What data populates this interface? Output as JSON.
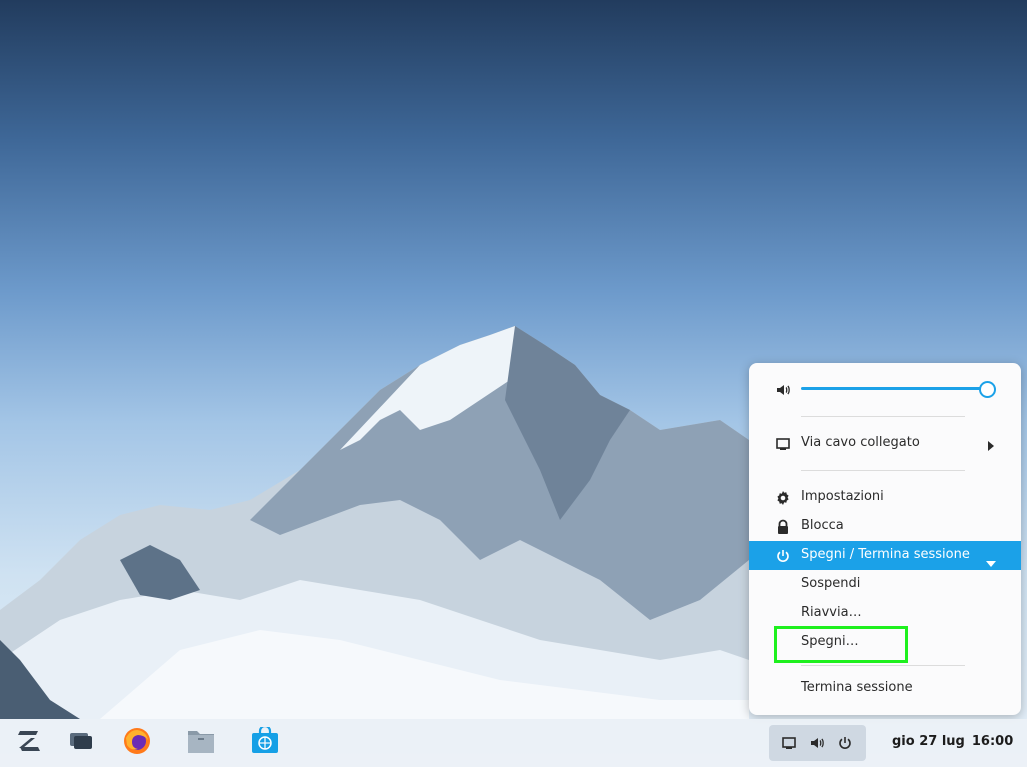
{
  "popup": {
    "volume": {
      "level": 1.0
    },
    "network": {
      "label": "Via cavo collegato"
    },
    "settings": {
      "label": "Impostazioni"
    },
    "lock": {
      "label": "Blocca"
    },
    "power": {
      "label": "Spegni / Termina sessione",
      "items": [
        {
          "label": "Sospendi"
        },
        {
          "label": "Riavvia…"
        },
        {
          "label": "Spegni…"
        }
      ]
    },
    "logout": {
      "label": "Termina sessione"
    }
  },
  "taskbar": {
    "launchers": [
      "zorin-menu-icon",
      "workspaces-icon",
      "firefox-icon",
      "files-icon",
      "software-store-icon"
    ],
    "tray": [
      "display-icon",
      "volume-icon",
      "power-icon"
    ],
    "clock": {
      "date": "gio 27 lug",
      "time": "16:00"
    }
  },
  "colors": {
    "accent": "#1ba1e8",
    "highlight": "#1ef01e",
    "panel": "#fbfbfc"
  }
}
